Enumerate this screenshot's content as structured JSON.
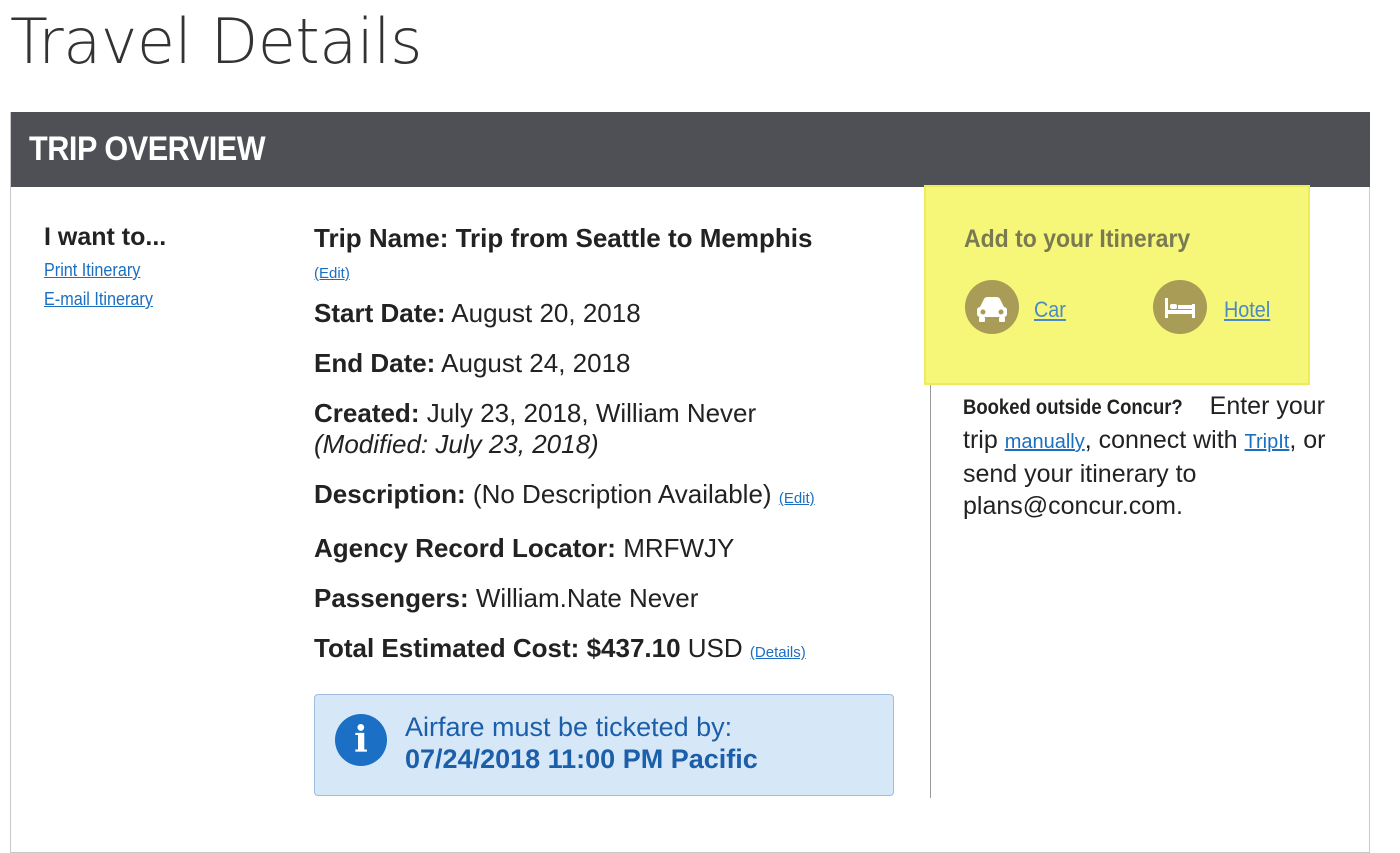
{
  "page": {
    "title": "Travel Details"
  },
  "panel": {
    "header": "TRIP OVERVIEW"
  },
  "actions": {
    "title": "I want to...",
    "print": "Print Itinerary",
    "email": "E-mail Itinerary"
  },
  "trip": {
    "name_label": "Trip Name:",
    "name_value": "Trip from Seattle to Memphis",
    "edit_label": "(Edit)",
    "start_label": "Start Date:",
    "start_value": "August 20, 2018",
    "end_label": "End Date:",
    "end_value": "August 24, 2018",
    "created_label": "Created:",
    "created_value": "July 23, 2018, William Never",
    "modified": "(Modified: July 23, 2018)",
    "description_label": "Description:",
    "description_value": "(No Description Available)",
    "locator_label": "Agency Record Locator:",
    "locator_value": "MRFWJY",
    "passengers_label": "Passengers:",
    "passengers_value": "William.Nate Never",
    "cost_label": "Total Estimated Cost:",
    "cost_amount": "$437.10",
    "cost_currency": "USD",
    "details_link": "(Details)"
  },
  "notice": {
    "line1": "Airfare must be ticketed by:",
    "line2": "07/24/2018 11:00 PM Pacific"
  },
  "itinerary": {
    "title": "Add to your Itinerary",
    "car": "Car",
    "hotel": "Hotel"
  },
  "outside": {
    "question": "Booked outside Concur?",
    "text1": "Enter your trip",
    "manually": "manually",
    "text2": ", connect with",
    "tripit": "TripIt",
    "text3": ", or send your itinerary to plans@concur.com."
  },
  "colors": {
    "header_bg": "#4e5056",
    "link": "#1a6fc2",
    "highlight": "#f6f679",
    "notice_bg": "#d6e7f7"
  }
}
